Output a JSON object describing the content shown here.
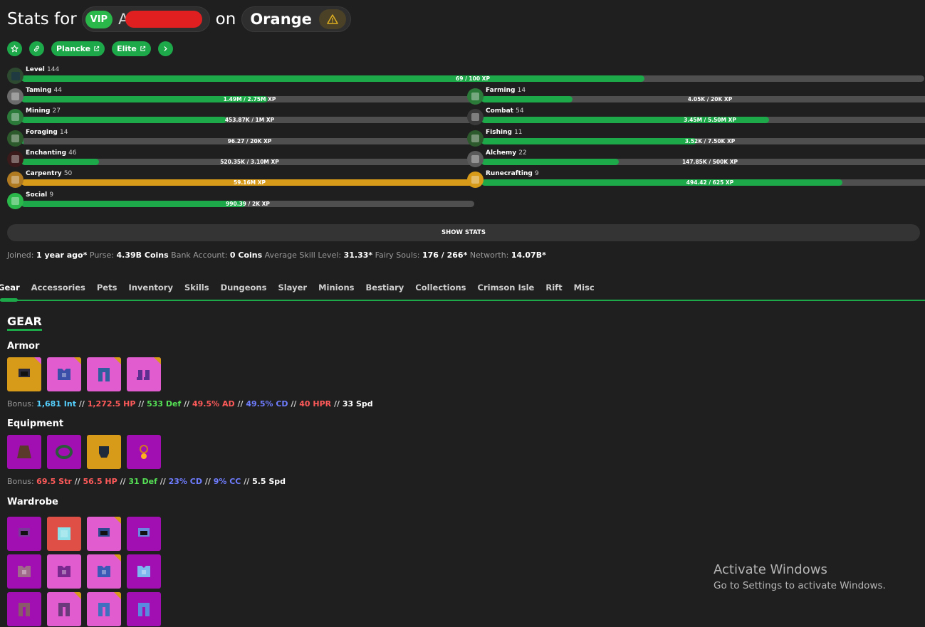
{
  "header": {
    "stats_for": "Stats for",
    "rank_badge": "VIP",
    "player_name_visible": "A",
    "on_text": "on",
    "profile_name": "Orange"
  },
  "links": {
    "plancke": "Plancke",
    "elite": "Elite"
  },
  "skills": {
    "level": {
      "name": "Level",
      "level": "144",
      "progress_text": "69 / 100 XP",
      "progress": 0.69
    },
    "left": [
      {
        "name": "Taming",
        "level": "44",
        "progress_text": "1.49M / 2.75M XP",
        "progress": 0.54,
        "color": "#1da84a"
      },
      {
        "name": "Mining",
        "level": "27",
        "progress_text": "453.87K / 1M XP",
        "progress": 0.45,
        "color": "#1da84a"
      },
      {
        "name": "Foraging",
        "level": "14",
        "progress_text": "96.27 / 20K XP",
        "progress": 0.005,
        "color": "#1da84a"
      },
      {
        "name": "Enchanting",
        "level": "46",
        "progress_text": "520.35K / 3.10M XP",
        "progress": 0.17,
        "color": "#1da84a"
      },
      {
        "name": "Carpentry",
        "level": "50",
        "progress_text": "59.16M XP",
        "progress": 1.0,
        "color": "#d79a19"
      },
      {
        "name": "Social",
        "level": "9",
        "progress_text": "990.39 / 2K XP",
        "progress": 0.495,
        "color": "#1da84a"
      }
    ],
    "right": [
      {
        "name": "Farming",
        "level": "14",
        "progress_text": "4.05K / 20K XP",
        "progress": 0.2,
        "color": "#1da84a"
      },
      {
        "name": "Combat",
        "level": "54",
        "progress_text": "3.45M / 5.50M XP",
        "progress": 0.63,
        "color": "#1da84a"
      },
      {
        "name": "Fishing",
        "level": "11",
        "progress_text": "3.52K / 7.50K XP",
        "progress": 0.47,
        "color": "#1da84a"
      },
      {
        "name": "Alchemy",
        "level": "22",
        "progress_text": "147.85K / 500K XP",
        "progress": 0.3,
        "color": "#1da84a"
      },
      {
        "name": "Runecrafting",
        "level": "9",
        "progress_text": "494.42 / 625 XP",
        "progress": 0.79,
        "color": "#1da84a"
      }
    ]
  },
  "show_stats_label": "SHOW STATS",
  "info": {
    "joined_label": "Joined:",
    "joined_value": "1 year ago*",
    "purse_label": "Purse:",
    "purse_value": "4.39B Coins",
    "bank_label": "Bank Account:",
    "bank_value": "0 Coins",
    "avg_label": "Average Skill Level:",
    "avg_value": "31.33*",
    "souls_label": "Fairy Souls:",
    "souls_value": "176 / 266*",
    "networth_label": "Networth:",
    "networth_value": "14.07B*"
  },
  "tabs": [
    "Gear",
    "Accessories",
    "Pets",
    "Inventory",
    "Skills",
    "Dungeons",
    "Slayer",
    "Minions",
    "Bestiary",
    "Collections",
    "Crimson Isle",
    "Rift",
    "Misc"
  ],
  "active_tab": "Gear",
  "gear": {
    "heading": "GEAR",
    "armor_label": "Armor",
    "armor_bonus": {
      "label": "Bonus:",
      "items": [
        {
          "text": "1,681 Int",
          "color": "#55d0ff"
        },
        {
          "text": "1,272.5 HP",
          "color": "#ff5a5a"
        },
        {
          "text": "533 Def",
          "color": "#55e055"
        },
        {
          "text": "49.5% AD",
          "color": "#ff5a5a"
        },
        {
          "text": "49.5% CD",
          "color": "#6f7dff"
        },
        {
          "text": "40 HPR",
          "color": "#ff5a5a"
        },
        {
          "text": "33 Spd",
          "color": "#ffffff"
        }
      ]
    },
    "equipment_label": "Equipment",
    "equipment_bonus": {
      "label": "Bonus:",
      "items": [
        {
          "text": "69.5 Str",
          "color": "#ff5a5a"
        },
        {
          "text": "56.5 HP",
          "color": "#ff5a5a"
        },
        {
          "text": "31 Def",
          "color": "#55e055"
        },
        {
          "text": "23% CD",
          "color": "#6f7dff"
        },
        {
          "text": "9% CC",
          "color": "#6f7dff"
        },
        {
          "text": "5.5 Spd",
          "color": "#ffffff"
        }
      ]
    },
    "wardrobe_label": "Wardrobe"
  },
  "colors": {
    "accent": "#1da84a",
    "legendary": "#d79a19",
    "mythic": "#e15ccf",
    "epic": "#a10fb3",
    "special": "#e04f46"
  },
  "watermark": {
    "line1": "Activate Windows",
    "line2": "Go to Settings to activate Windows."
  }
}
